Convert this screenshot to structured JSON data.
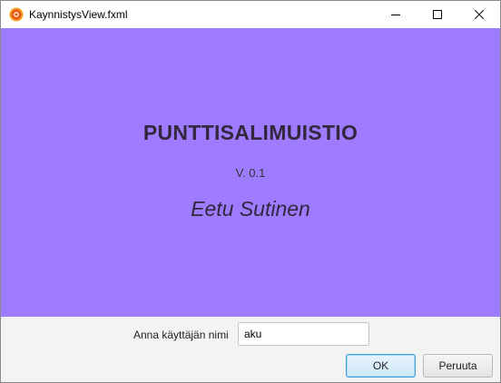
{
  "window": {
    "title": "KaynnistysView.fxml",
    "icon": "app-logo-icon",
    "controls": {
      "minimize": "minimize-icon",
      "maximize": "maximize-icon",
      "close": "close-icon"
    }
  },
  "banner": {
    "title": "PUNTTISALIMUISTIO",
    "version": "V. 0.1",
    "author": "Eetu Sutinen",
    "background_color": "#9f7cff"
  },
  "form": {
    "username_label": "Anna käyttäjän nimi",
    "username_value": "aku"
  },
  "buttons": {
    "ok_label": "OK",
    "cancel_label": "Peruuta"
  }
}
